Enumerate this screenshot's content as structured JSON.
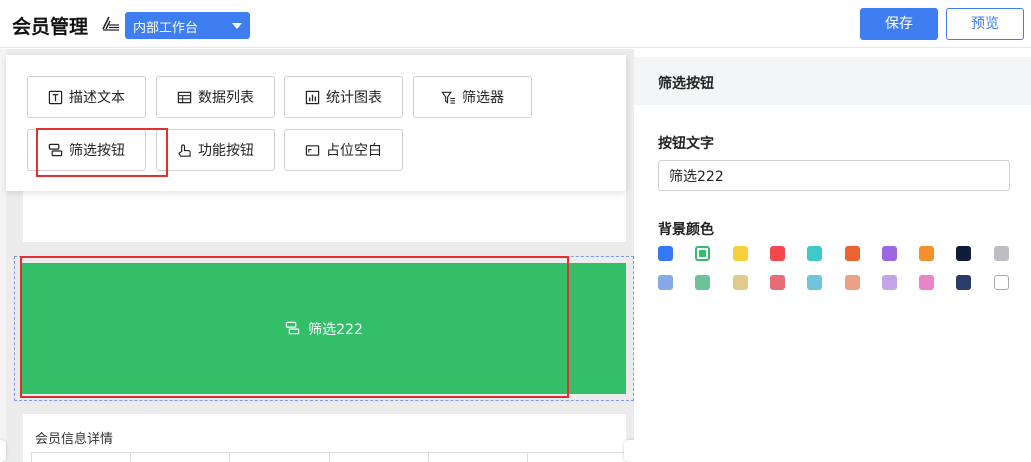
{
  "header": {
    "title": "会员管理",
    "workspace": "内部工作台",
    "save_label": "保存",
    "preview_label": "预览"
  },
  "palette": {
    "items": [
      {
        "label": "描述文本",
        "icon": "text-box-icon"
      },
      {
        "label": "数据列表",
        "icon": "table-icon"
      },
      {
        "label": "统计图表",
        "icon": "bar-chart-icon"
      },
      {
        "label": "筛选器",
        "icon": "filter-icon"
      },
      {
        "label": "筛选按钮",
        "icon": "filter-button-icon"
      },
      {
        "label": "功能按钮",
        "icon": "function-button-icon"
      },
      {
        "label": "占位空白",
        "icon": "placeholder-icon"
      }
    ]
  },
  "canvas": {
    "filter_button_text": "筛选222",
    "table_title": "会员信息详情"
  },
  "panel": {
    "title": "筛选按钮",
    "button_text_label": "按钮文字",
    "button_text_value": "筛选222",
    "bg_color_label": "背景颜色",
    "colors_row1": [
      "#3478f6",
      "#33bf67",
      "#f7cf3e",
      "#f5484d",
      "#3ec9c9",
      "#ec6230",
      "#9e67e2",
      "#f78f2e",
      "#0f1d3a",
      "#bcbec3"
    ],
    "colors_row2": [
      "#85a8e8",
      "#6cc399",
      "#e0cb8a",
      "#e56e72",
      "#6fc6da",
      "#eca08a",
      "#c3a4e8",
      "#e886c7",
      "#2a3d66",
      "#ffffff"
    ],
    "selected_color": "#33bf67"
  }
}
